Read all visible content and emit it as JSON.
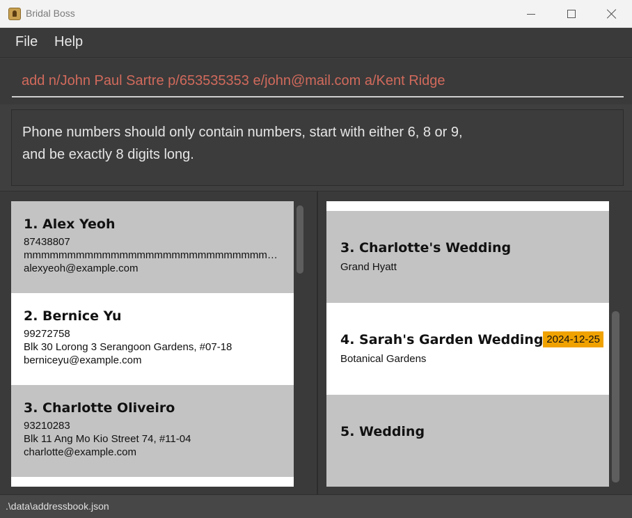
{
  "window": {
    "title": "Bridal Boss",
    "icon": "app-icon"
  },
  "menu": {
    "items": [
      "File",
      "Help"
    ]
  },
  "command": {
    "value": "add n/John Paul Sartre p/653535353 e/john@mail.com a/Kent Ridge",
    "text_color": "#d16a5c"
  },
  "result": {
    "line1": "Phone numbers should only contain numbers, start with either 6, 8 or 9,",
    "line2": "and be exactly 8 digits long."
  },
  "persons": [
    {
      "name": "1. Alex Yeoh",
      "phone": "87438807",
      "address": "mmmmmmmmmmmmmmmmmmmmmmmmmmmmmmmmmm...",
      "email": "alexyeoh@example.com"
    },
    {
      "name": "2. Bernice Yu",
      "phone": "99272758",
      "address": "Blk 30 Lorong 3 Serangoon Gardens, #07-18",
      "email": "berniceyu@example.com"
    },
    {
      "name": "3. Charlotte Oliveiro",
      "phone": "93210283",
      "address": "Blk 11 Ang Mo Kio Street 74, #11-04",
      "email": "charlotte@example.com"
    }
  ],
  "weddings": [
    {
      "title": "3. Charlotte's Wedding",
      "venue": "Grand Hyatt",
      "date": ""
    },
    {
      "title": "4. Sarah's Garden Wedding",
      "venue": "Botanical Gardens",
      "date": "2024-12-25"
    },
    {
      "title": "5. Wedding",
      "venue": "",
      "date": ""
    }
  ],
  "colors": {
    "card_grey": "#c3c3c3",
    "card_white": "#ffffff",
    "date_badge": "#f0a200"
  },
  "status": {
    "file_path": ".\\data\\addressbook.json"
  }
}
